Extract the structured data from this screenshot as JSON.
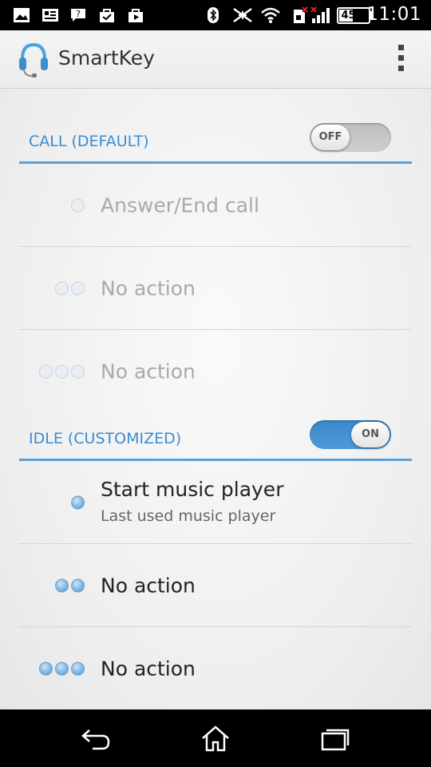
{
  "status_bar": {
    "time": "11:01",
    "battery_percent": "45%",
    "battery_level": 0.45,
    "icons": [
      "gallery-icon",
      "news-icon",
      "chat-icon",
      "shopping-bag-icon",
      "play-store-icon",
      "bluetooth-icon",
      "nfc-icon",
      "wifi-icon",
      "no-sim-icon",
      "signal-icon",
      "battery-icon"
    ]
  },
  "action_bar": {
    "title": "SmartKey",
    "app_icon": "headset-icon",
    "menu_icon": "overflow-menu-icon"
  },
  "sections": [
    {
      "title": "CALL (DEFAULT)",
      "toggle_label": "OFF",
      "enabled": false,
      "rows": [
        {
          "presses": 1,
          "label": "Answer/End call"
        },
        {
          "presses": 2,
          "label": "No action"
        },
        {
          "presses": 3,
          "label": "No action"
        }
      ]
    },
    {
      "title": "IDLE (CUSTOMIZED)",
      "toggle_label": "ON",
      "enabled": true,
      "rows": [
        {
          "presses": 1,
          "label": "Start music player",
          "sublabel": "Last used music player"
        },
        {
          "presses": 2,
          "label": "No action"
        },
        {
          "presses": 3,
          "label": "No action"
        }
      ]
    }
  ],
  "nav_bar": {
    "icons": [
      "back-icon",
      "home-icon",
      "recent-apps-icon"
    ]
  },
  "colors": {
    "accent": "#3b8ccf",
    "divider": "#5b9fd4",
    "toggle_on": "#4a94d4",
    "toggle_off": "#c4c4c4"
  }
}
